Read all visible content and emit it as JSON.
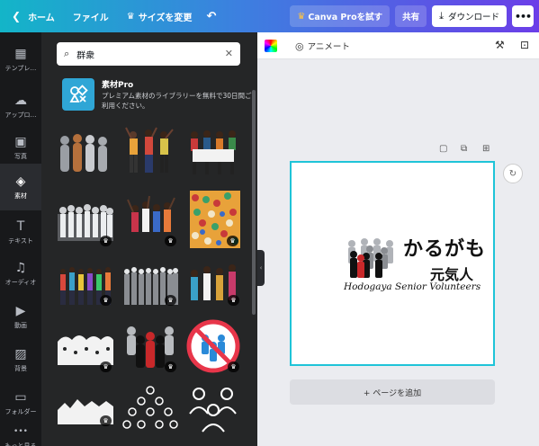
{
  "topbar": {
    "home_label": "ホーム",
    "file_label": "ファイル",
    "resize_label": "サイズを変更",
    "pro_label": "Canva Proを試す",
    "share_label": "共有",
    "download_label": "ダウンロード",
    "more_label": "•••"
  },
  "sidebar": {
    "items": [
      {
        "label": "テンプレ…",
        "icon": "▦"
      },
      {
        "label": "アップロ…",
        "icon": "☁"
      },
      {
        "label": "写真",
        "icon": "▣"
      },
      {
        "label": "素材",
        "icon": "◈"
      },
      {
        "label": "テキスト",
        "icon": "T"
      },
      {
        "label": "オーディオ",
        "icon": "♫"
      },
      {
        "label": "動画",
        "icon": "▶"
      },
      {
        "label": "背景",
        "icon": "▨"
      },
      {
        "label": "フォルダー",
        "icon": "▭"
      },
      {
        "label": "もっと見る",
        "icon": "•••"
      }
    ]
  },
  "search": {
    "value": "群衆",
    "placeholder": ""
  },
  "promo": {
    "title": "素材Pro",
    "description": "プレミアム素材のライブラリーを無料で30日間ご利用ください。"
  },
  "editor": {
    "animate_label": "アニメート",
    "add_page_label": "+ ページを追加"
  },
  "design": {
    "line1": "かるがも",
    "line2": "元気人",
    "line3": "Hodogaya Senior Volunteers"
  },
  "colors": {
    "accent": "#1fc4d8",
    "sidebar_bg": "#18191b",
    "panel_bg": "#252627"
  }
}
